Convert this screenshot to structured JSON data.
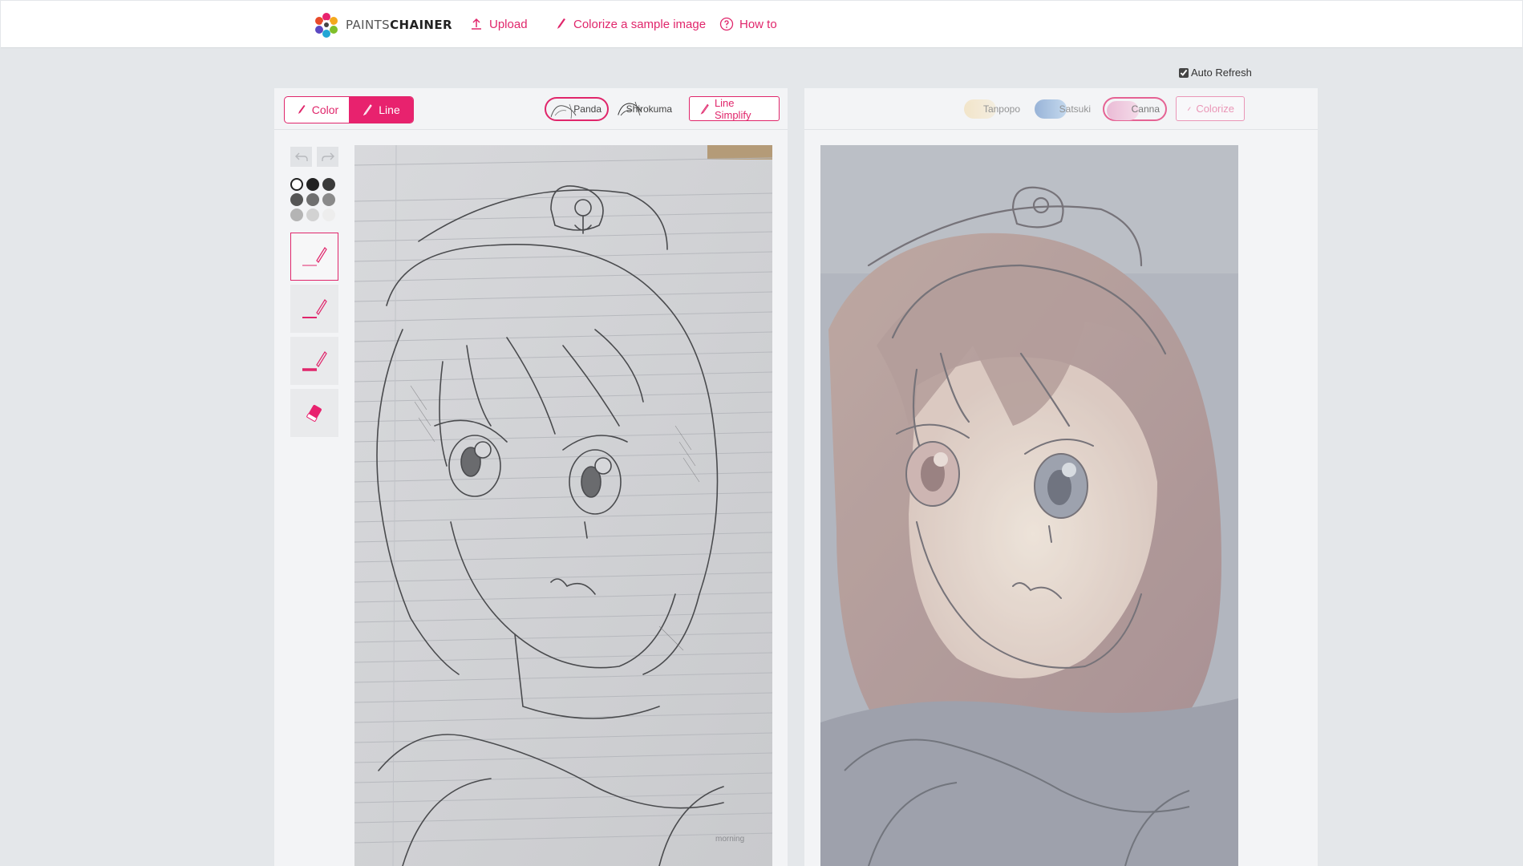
{
  "header": {
    "logo_paints": "PAINTS",
    "logo_chainer": "CHAINER",
    "nav": [
      {
        "label": "Upload",
        "icon": "upload-icon"
      },
      {
        "label": "Colorize a sample image",
        "icon": "brush-icon"
      },
      {
        "label": "How to",
        "icon": "help-circle-icon"
      }
    ]
  },
  "options": {
    "auto_refresh_label": "Auto Refresh",
    "auto_refresh_checked": true
  },
  "left_panel": {
    "mode_tabs": [
      {
        "label": "Color",
        "active": false
      },
      {
        "label": "Line",
        "active": true
      }
    ],
    "line_models": [
      {
        "label": "Panda",
        "selected": true
      },
      {
        "label": "Shirokuma",
        "selected": false
      }
    ],
    "line_simplify_label": "Line Simplify",
    "tools": {
      "undo_icon": "undo-icon",
      "redo_icon": "redo-icon",
      "swatches": [
        "#ffffff",
        "#222222",
        "#3a3a3a",
        "#555555",
        "#6f6f6f",
        "#8a8a8a",
        "#b4b4b4",
        "#d2d2d2",
        "#ededed"
      ],
      "pens": [
        {
          "name": "pen-thin",
          "selected": true
        },
        {
          "name": "pen-medium",
          "selected": false
        },
        {
          "name": "pen-thick",
          "selected": false
        },
        {
          "name": "eraser",
          "selected": false
        }
      ]
    }
  },
  "right_panel": {
    "color_models": [
      {
        "label": "Tanpopo",
        "selected": false
      },
      {
        "label": "Satsuki",
        "selected": false
      },
      {
        "label": "Canna",
        "selected": true
      }
    ],
    "colorize_label": "Colorize"
  },
  "colors": {
    "accent": "#e0266b",
    "background": "#e4e7ea",
    "panel": "#f3f4f6"
  }
}
